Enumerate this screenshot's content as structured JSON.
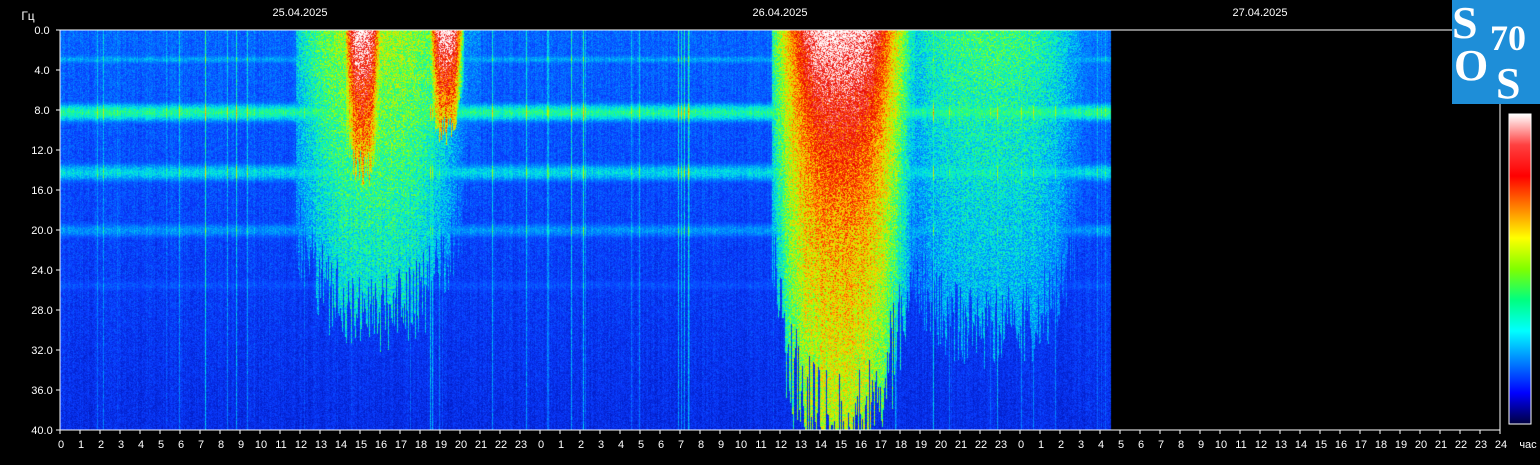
{
  "chart_data": {
    "type": "heatmap",
    "y_unit": "Гц",
    "x_unit": "час",
    "ylim": [
      40.0,
      0.0
    ],
    "y_ticks": [
      "0.0",
      "4.0",
      "8.0",
      "12.0",
      "16.0",
      "20.0",
      "24.0",
      "28.0",
      "32.0",
      "36.0",
      "40.0"
    ],
    "x_ticks": [
      "0",
      "1",
      "2",
      "3",
      "4",
      "5",
      "6",
      "7",
      "8",
      "9",
      "10",
      "11",
      "12",
      "13",
      "14",
      "15",
      "16",
      "17",
      "18",
      "19",
      "20",
      "21",
      "22",
      "23",
      "0",
      "1",
      "2",
      "3",
      "4",
      "5",
      "6",
      "7",
      "8",
      "9",
      "10",
      "11",
      "12",
      "13",
      "14",
      "15",
      "16",
      "17",
      "18",
      "19",
      "20",
      "21",
      "22",
      "23",
      "0",
      "1",
      "2",
      "3",
      "4",
      "5",
      "6",
      "7",
      "8",
      "9",
      "10",
      "11",
      "12",
      "13",
      "14",
      "15",
      "16",
      "17",
      "18",
      "19",
      "20",
      "21",
      "22",
      "23",
      "24"
    ],
    "dates": [
      {
        "label": "25.04.2025",
        "at_hour": 12
      },
      {
        "label": "26.04.2025",
        "at_hour": 36
      },
      {
        "label": "27.04.2025",
        "at_hour": 60
      }
    ],
    "x_range_hours": [
      0,
      72
    ],
    "data_end_hour": 52.5,
    "bands": [
      {
        "y_from": 2.2,
        "y_to": 3.6,
        "level": 0.42
      },
      {
        "y_from": 6.8,
        "y_to": 9.6,
        "level": 0.55
      },
      {
        "y_from": 12.8,
        "y_to": 15.6,
        "level": 0.48
      },
      {
        "y_from": 18.8,
        "y_to": 21.2,
        "level": 0.4
      },
      {
        "y_from": 24.5,
        "y_to": 26.5,
        "level": 0.3
      }
    ],
    "bursts": [
      {
        "hour_from": 11.8,
        "hour_to": 21.0,
        "peak_hour": 15.8,
        "y_max": 28,
        "level": 0.68
      },
      {
        "hour_from": 14.3,
        "hour_to": 16.2,
        "peak_hour": 15.1,
        "y_max": 14,
        "level": 1.0
      },
      {
        "hour_from": 18.5,
        "hour_to": 20.2,
        "peak_hour": 19.3,
        "y_max": 10,
        "level": 1.0
      },
      {
        "hour_from": 35.6,
        "hour_to": 42.7,
        "peak_hour": 39.0,
        "y_max": 40,
        "level": 0.9
      },
      {
        "hour_from": 36.2,
        "hour_to": 42.1,
        "peak_hour": 39.0,
        "y_max": 18,
        "level": 1.0
      },
      {
        "hour_from": 42.5,
        "hour_to": 52.4,
        "peak_hour": 46.5,
        "y_max": 30,
        "level": 0.6
      }
    ],
    "colorbar": [
      "#ffffff",
      "#ff4040",
      "#ff0000",
      "#ff8000",
      "#ffff00",
      "#80ff00",
      "#00ff80",
      "#00ffff",
      "#0080ff",
      "#0000ff",
      "#000040"
    ]
  },
  "logo": {
    "letters": [
      "S",
      "O",
      "S"
    ],
    "number": "70",
    "bg_color": "#1e8ed8"
  }
}
